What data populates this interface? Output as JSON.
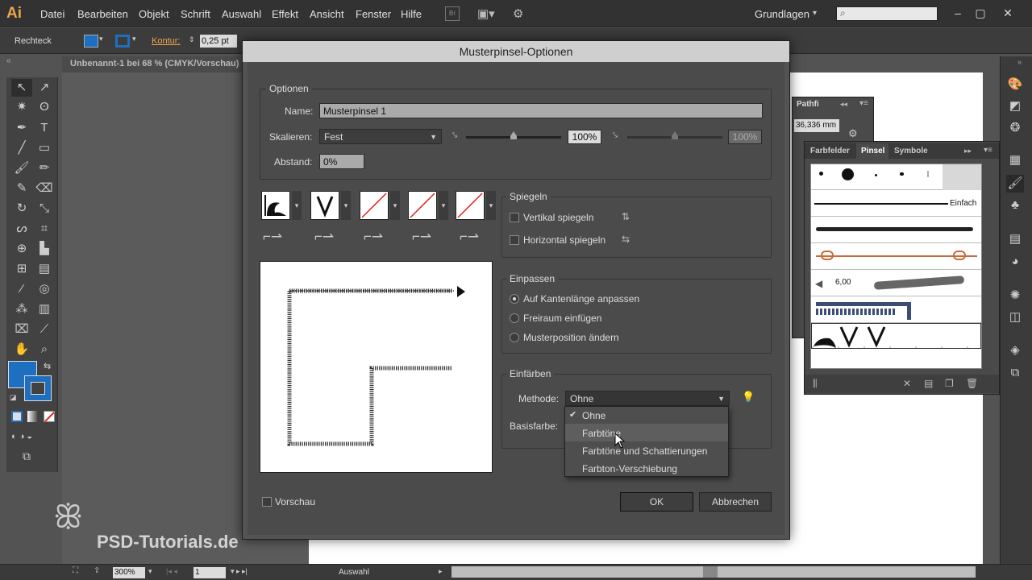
{
  "app": {
    "logo": "Ai"
  },
  "menu": [
    "Datei",
    "Bearbeiten",
    "Objekt",
    "Schrift",
    "Auswahl",
    "Effekt",
    "Ansicht",
    "Fenster",
    "Hilfe"
  ],
  "workspace": "Grundlagen",
  "controlbar": {
    "object_type": "Rechteck",
    "stroke_label": "Kontur:",
    "stroke_width": "0,25 pt",
    "fill_color": "#1f6fc0"
  },
  "document_tab": "Unbenannt-1 bei 68 % (CMYK/Vorschau)",
  "status": {
    "zoom": "300%",
    "page": "1",
    "selection": "Auswahl"
  },
  "pathfinder": {
    "title": "Pathfi",
    "value": "36,336 mm"
  },
  "brushes_panel": {
    "tabs": [
      "Farbfelder",
      "Pinsel",
      "Symbole"
    ],
    "basic_label": "Einfach",
    "size_label": "6,00"
  },
  "dialog": {
    "title": "Musterpinsel-Optionen",
    "options_group": "Optionen",
    "name_label": "Name:",
    "name_value": "Musterpinsel 1",
    "scale_label": "Skalieren:",
    "scale_value": "Fest",
    "scale_pct": "100%",
    "scale_pct2": "100%",
    "spacing_label": "Abstand:",
    "spacing_value": "0%",
    "flip_group": "Spiegeln",
    "flip_vertical": "Vertikal spiegeln",
    "flip_horizontal": "Horizontal spiegeln",
    "fit_group": "Einpassen",
    "fit_options": [
      "Auf Kantenlänge anpassen",
      "Freiraum einfügen",
      "Musterposition ändern"
    ],
    "colorize_group": "Einfärben",
    "method_label": "Methode:",
    "method_value": "Ohne",
    "basecolor_label": "Basisfarbe:",
    "method_options": [
      "Ohne",
      "Farbtöne",
      "Farbtöne und Schattierungen",
      "Farbton-Verschiebung"
    ],
    "preview_label": "Vorschau",
    "ok_label": "OK",
    "cancel_label": "Abbrechen"
  },
  "watermark": "PSD-Tutorials.de"
}
